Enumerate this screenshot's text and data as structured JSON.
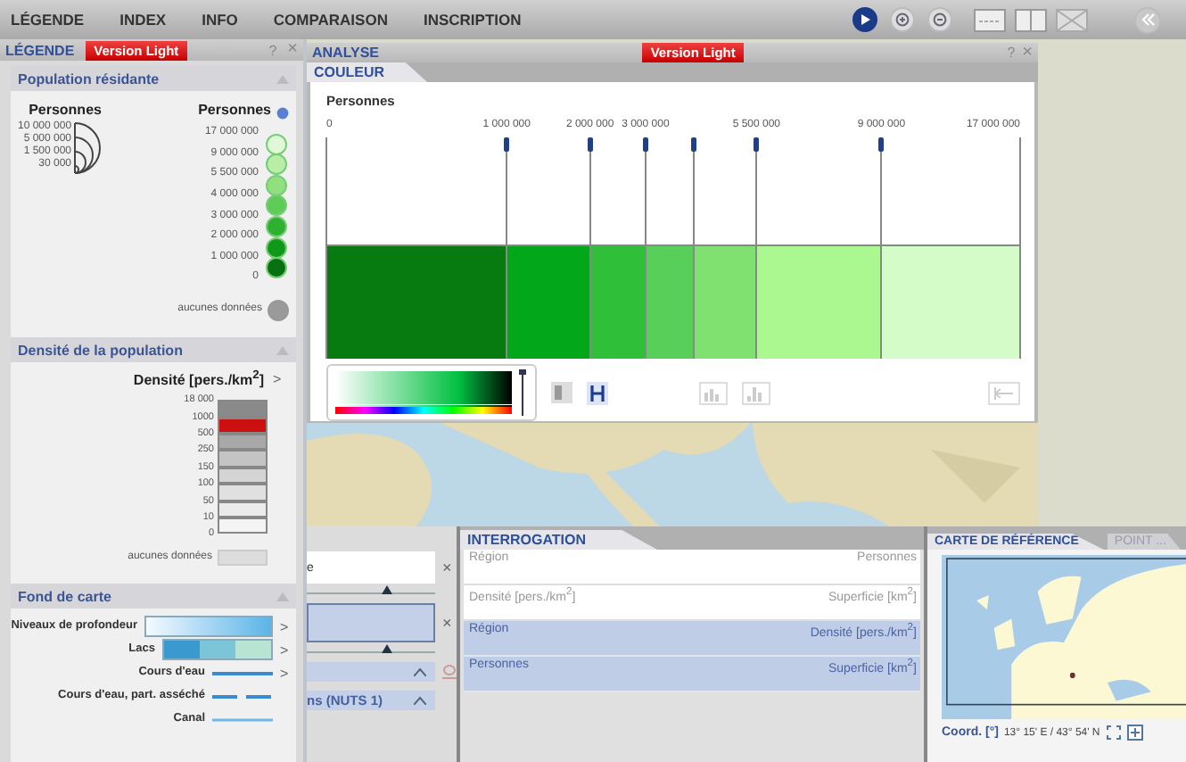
{
  "menu": [
    {
      "label": "LÉGENDE"
    },
    {
      "label": "INDEX"
    },
    {
      "label": "INFO"
    },
    {
      "label": "COMPARAISON"
    },
    {
      "label": "INSCRIPTION"
    }
  ],
  "tools": [
    {
      "kind": "pointer",
      "selected": true
    },
    {
      "kind": "zoom-in",
      "selected": false
    },
    {
      "kind": "zoom-out",
      "selected": false
    }
  ],
  "legend": {
    "title": "LÉGENDE",
    "badge": "Version Light",
    "help": "?",
    "close": "×",
    "population": {
      "title": "Population résidante",
      "prop_title": "Personnes",
      "prop_values": [
        "10 000 000",
        "5 000 000",
        "1 500 000",
        "30 000"
      ],
      "class_title": "Personnes",
      "class_values": [
        "17 000 000",
        "9 000 000",
        "5 500 000",
        "4 000 000",
        "3 000 000",
        "2 000 000",
        "1 000 000",
        "0"
      ],
      "class_colors": [
        {
          "color": "#e0f8d8"
        },
        {
          "color": "#b8eea8"
        },
        {
          "color": "#90e080"
        },
        {
          "color": "#60cc58"
        },
        {
          "color": "#30b030"
        },
        {
          "color": "#109818"
        },
        {
          "color": "#087010"
        }
      ],
      "no_data": "aucunes données"
    },
    "density": {
      "title": "Densité de la population",
      "unit": "Densité [pers./km$^{2}$]",
      "more": ">",
      "values": [
        "18 000",
        "1000",
        "500",
        "250",
        "150",
        "100",
        "50",
        "10",
        "0"
      ],
      "colors": [
        {
          "color": "#8a8a8a"
        },
        {
          "color": "#cc1010"
        },
        {
          "color": "#a8a8a8"
        },
        {
          "color": "#c4c4c4"
        },
        {
          "color": "#d4d4d4"
        },
        {
          "color": "#e0e0e0"
        },
        {
          "color": "#ebebeb"
        },
        {
          "color": "#f4f4f4"
        }
      ],
      "no_data": "aucunes données"
    },
    "basemap": {
      "title": "Fond de carte",
      "items": [
        {
          "kind": "gradient",
          "label": "Niveaux de profondeur",
          "more": ">"
        },
        {
          "kind": "swatches",
          "label": "Lacs",
          "more": ">"
        },
        {
          "kind": "line",
          "label": "Cours d'eau",
          "more": ">"
        },
        {
          "kind": "dashed",
          "label": "Cours d'eau, part. asséché"
        },
        {
          "kind": "thin",
          "label": "Canal"
        }
      ]
    }
  },
  "analysis": {
    "title": "ANALYSE",
    "badge": "Version Light",
    "help": "?",
    "close": "×",
    "tabs": [
      {
        "label": "COULEUR",
        "selected": true
      }
    ],
    "variable": "Personnes",
    "breaks": [
      {
        "label": "0",
        "level": 0
      },
      {
        "label": "1 000 000",
        "level": 0.26
      },
      {
        "label": "2 000 000",
        "level": 0.38
      },
      {
        "label": "3 000 000",
        "level": 0.46
      },
      {
        "level": 0.53
      },
      {
        "label": "5 500 000",
        "level": 0.62
      },
      {
        "label": "9 000 000",
        "level": 0.8
      },
      {
        "label": "17 000 000",
        "level": 1
      }
    ],
    "bands": [
      {
        "color": "#077a10"
      },
      {
        "color": "#02a81a"
      },
      {
        "color": "#30bf38"
      },
      {
        "color": "#58cf58"
      },
      {
        "color": "#80e070"
      },
      {
        "color": "#acf890"
      },
      {
        "color": "#d4fcc8"
      }
    ]
  },
  "layers": {
    "search": {
      "value": "e"
    },
    "clear_search": "×",
    "clear_selection": "×",
    "sliders": [
      {
        "level": 0.62
      },
      {
        "level": 0.62
      }
    ],
    "groups": [
      {
        "kind": "reset"
      },
      {
        "kind": "plain",
        "label": "ns (NUTS 1)"
      }
    ]
  },
  "interrogation": {
    "title": "INTERROGATION",
    "rows": [
      {
        "left": "Région",
        "right": "Personnes",
        "selected": false
      },
      {
        "left": "Densité [pers./km$^{2}$]",
        "right": "Superficie [km$^{2}$]",
        "selected": false
      },
      {
        "left": "Région",
        "right": "Densité [pers./km$^{2}$]",
        "selected": true
      },
      {
        "left": "Personnes",
        "right": "Superficie [km$^{2}$]",
        "selected": true
      }
    ]
  },
  "reference": {
    "tabs": [
      {
        "label": "CARTE DE RÉFÉRENCE",
        "selected": true
      },
      {
        "label": "POINT ...",
        "selected": false
      }
    ],
    "coord_label": "Coord. [°]",
    "coord_value": "13° 15' E / 43° 54' N"
  }
}
